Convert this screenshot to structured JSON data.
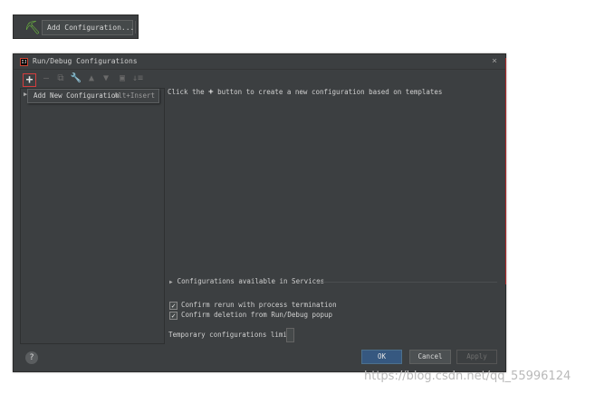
{
  "top_toolbar": {
    "build_icon": "hammer-icon",
    "add_config_label": "Add Configuration..."
  },
  "dialog": {
    "title": "Run/Debug Configurations",
    "app_icon_text": "IJ",
    "close_glyph": "×",
    "toolbar": {
      "add_glyph": "+",
      "remove_glyph": "—",
      "copy_glyph": "⧉",
      "edit_glyph": "🔧",
      "up_glyph": "▲",
      "down_glyph": "▼",
      "folder_glyph": "▣",
      "sort_glyph": "↓≡"
    },
    "tooltip": {
      "label": "Add New Configuration",
      "shortcut": "Alt+Insert"
    },
    "hint": {
      "before": "Click the",
      "plus": "+",
      "after": "button to create a new configuration based on templates"
    },
    "services_label": "Configurations available in Services",
    "checkboxes": [
      {
        "label": "Confirm rerun with process termination",
        "checked": true
      },
      {
        "label": "Confirm deletion from Run/Debug popup",
        "checked": true
      }
    ],
    "temp_limit_label": "Temporary configurations limit:",
    "temp_limit_value": "",
    "buttons": {
      "help": "?",
      "ok": "OK",
      "cancel": "Cancel",
      "apply": "Apply"
    }
  },
  "watermark": "https://blog.csdn.net/qq_55996124"
}
